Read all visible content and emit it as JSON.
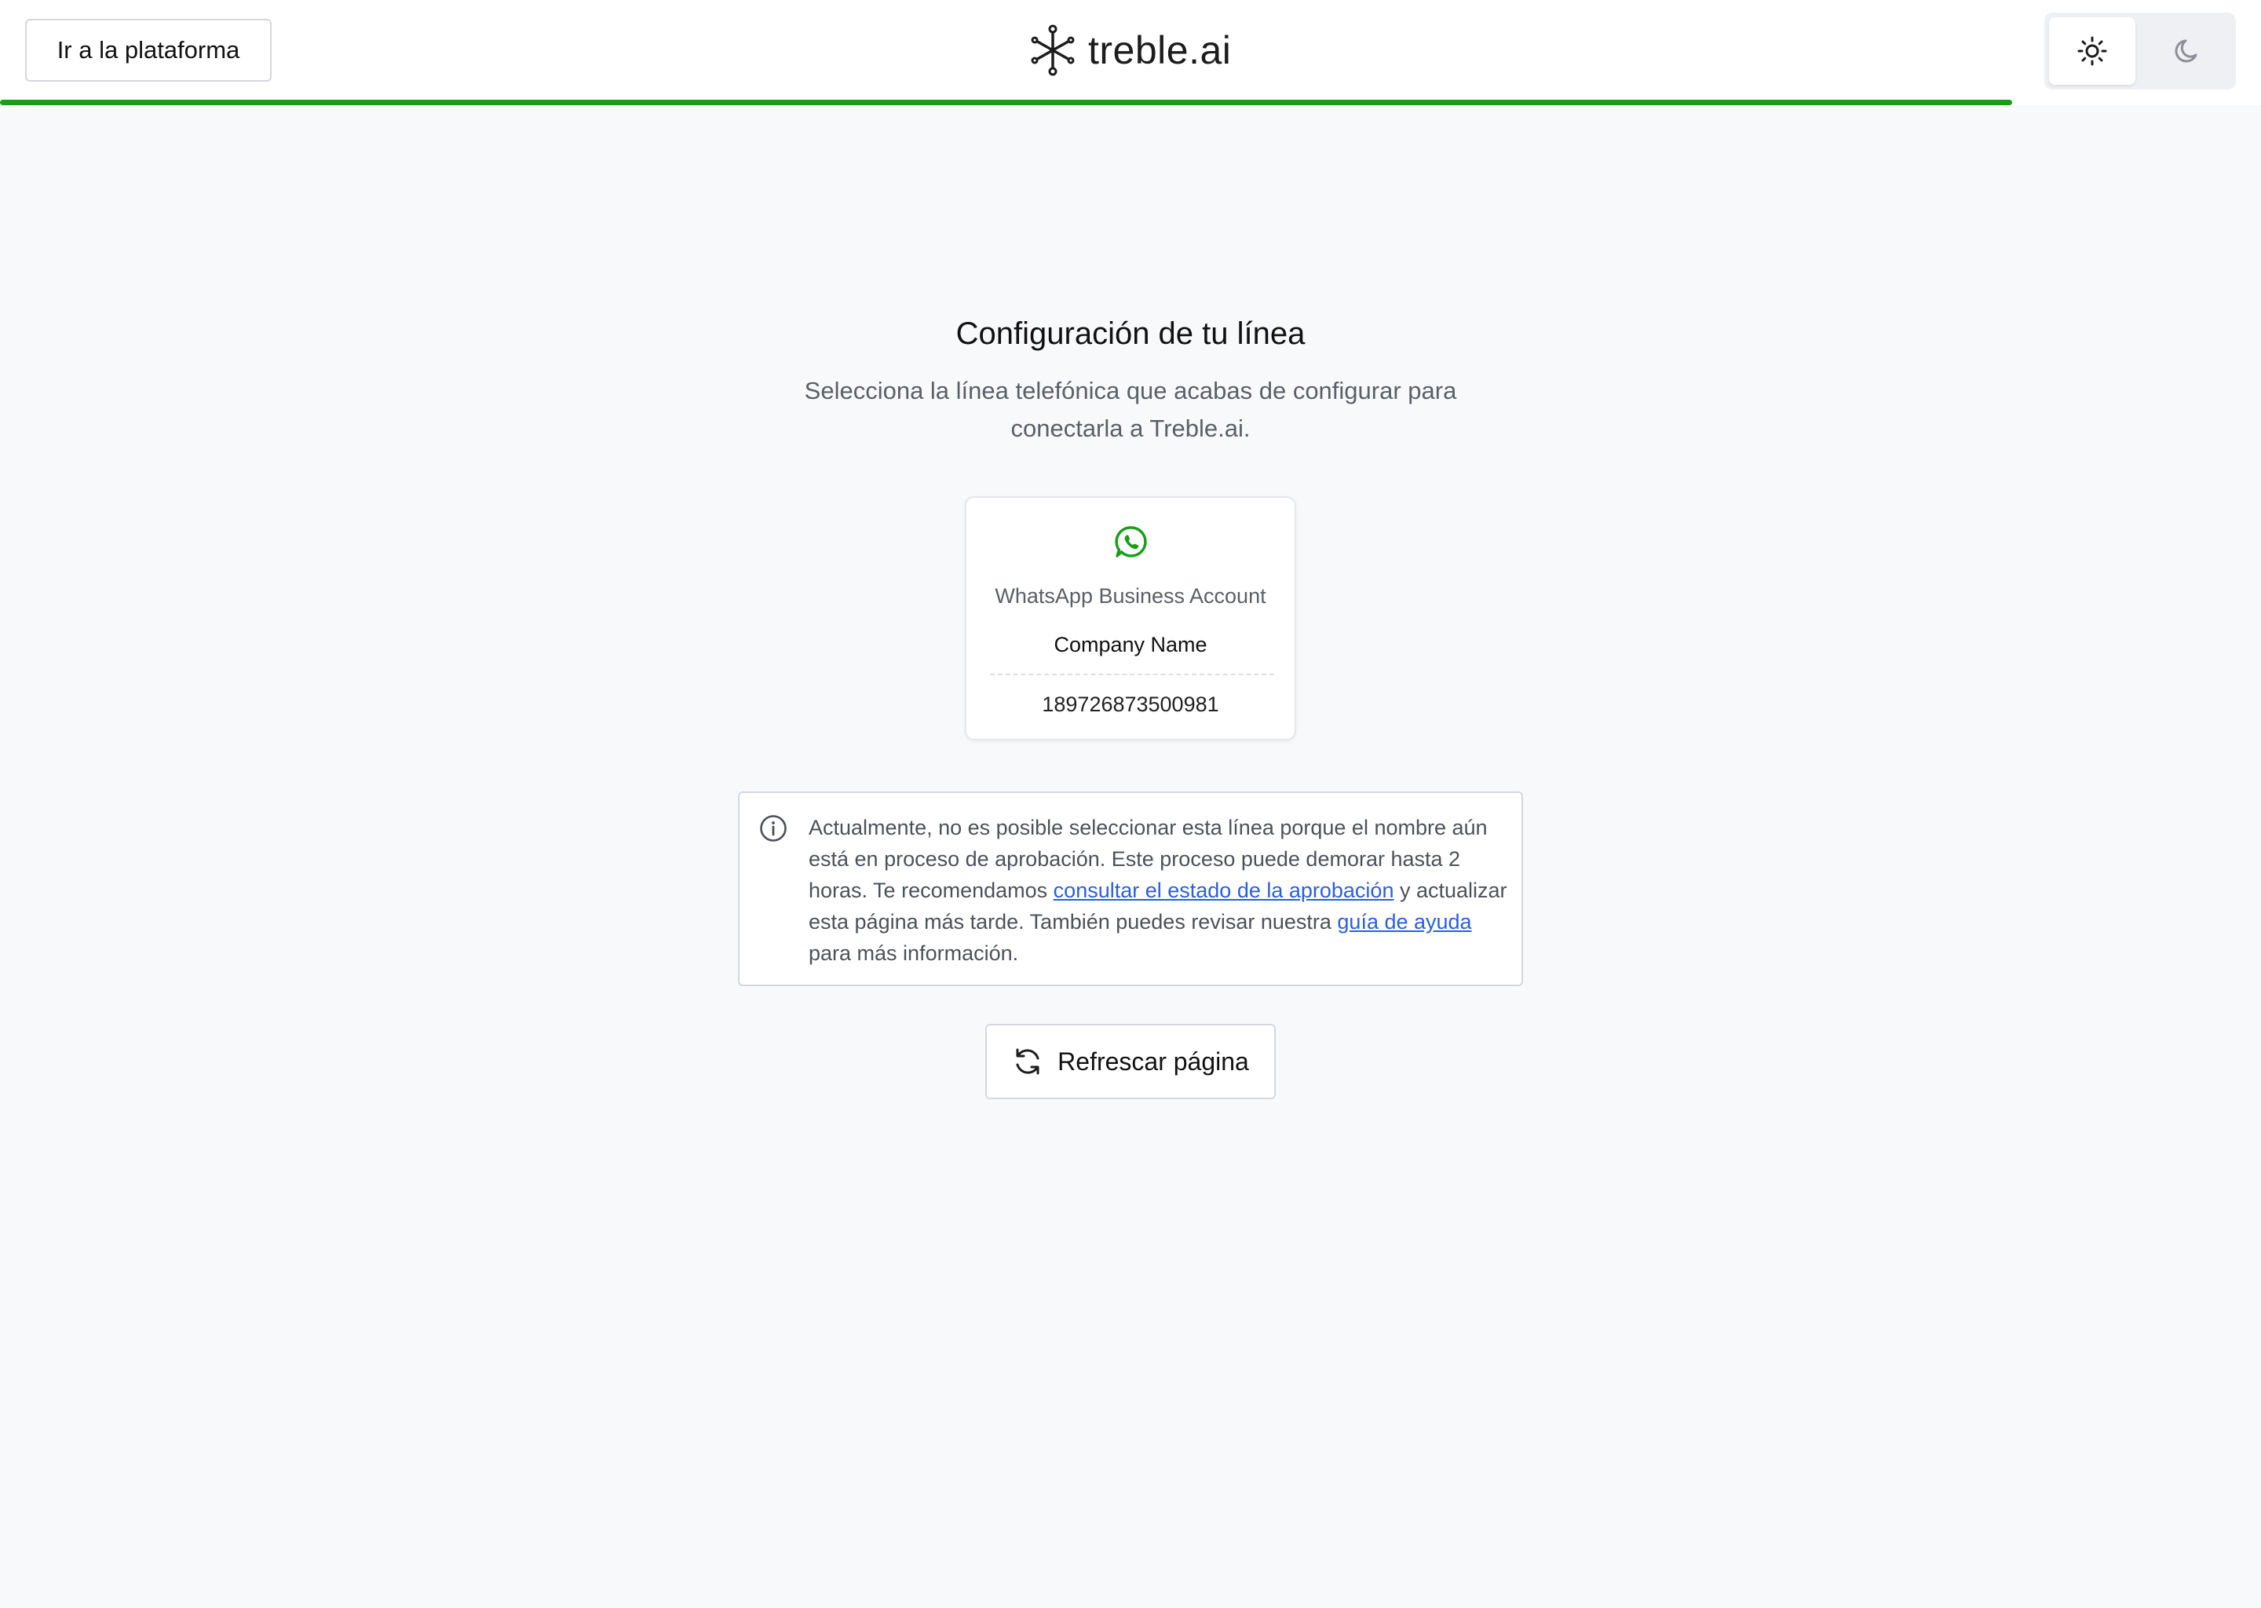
{
  "header": {
    "platform_button": "Ir a la plataforma",
    "brand": "treble.ai",
    "progress": 0.89,
    "theme_options": [
      "light",
      "dark"
    ],
    "theme_selected": "light"
  },
  "main": {
    "title": "Configuración de tu línea",
    "subtitle": "Selecciona la línea telefónica que acabas de configurar para conectarla a Treble.ai.",
    "line_card": {
      "icon": "whatsapp-icon",
      "label": "WhatsApp Business Account",
      "company": "Company Name",
      "number": "189726873500981"
    },
    "notice": {
      "icon": "info-icon",
      "text_1": "Actualmente, no es posible seleccionar esta línea porque el nombre aún está en proceso de aprobación. Este proceso puede demorar hasta 2 horas. Te recomendamos ",
      "link_1": "consultar el estado de la aprobación",
      "text_2": " y actualizar esta página más tarde. También puedes revisar nuestra ",
      "link_2": "guía de ayuda",
      "text_3": " para más información."
    },
    "refresh_button": "Refrescar página"
  },
  "colors": {
    "accent_green": "#1a9e1a",
    "whatsapp_green": "#1a9e1a",
    "link_blue": "#2b5fd9",
    "background": "#f8f9fb"
  }
}
